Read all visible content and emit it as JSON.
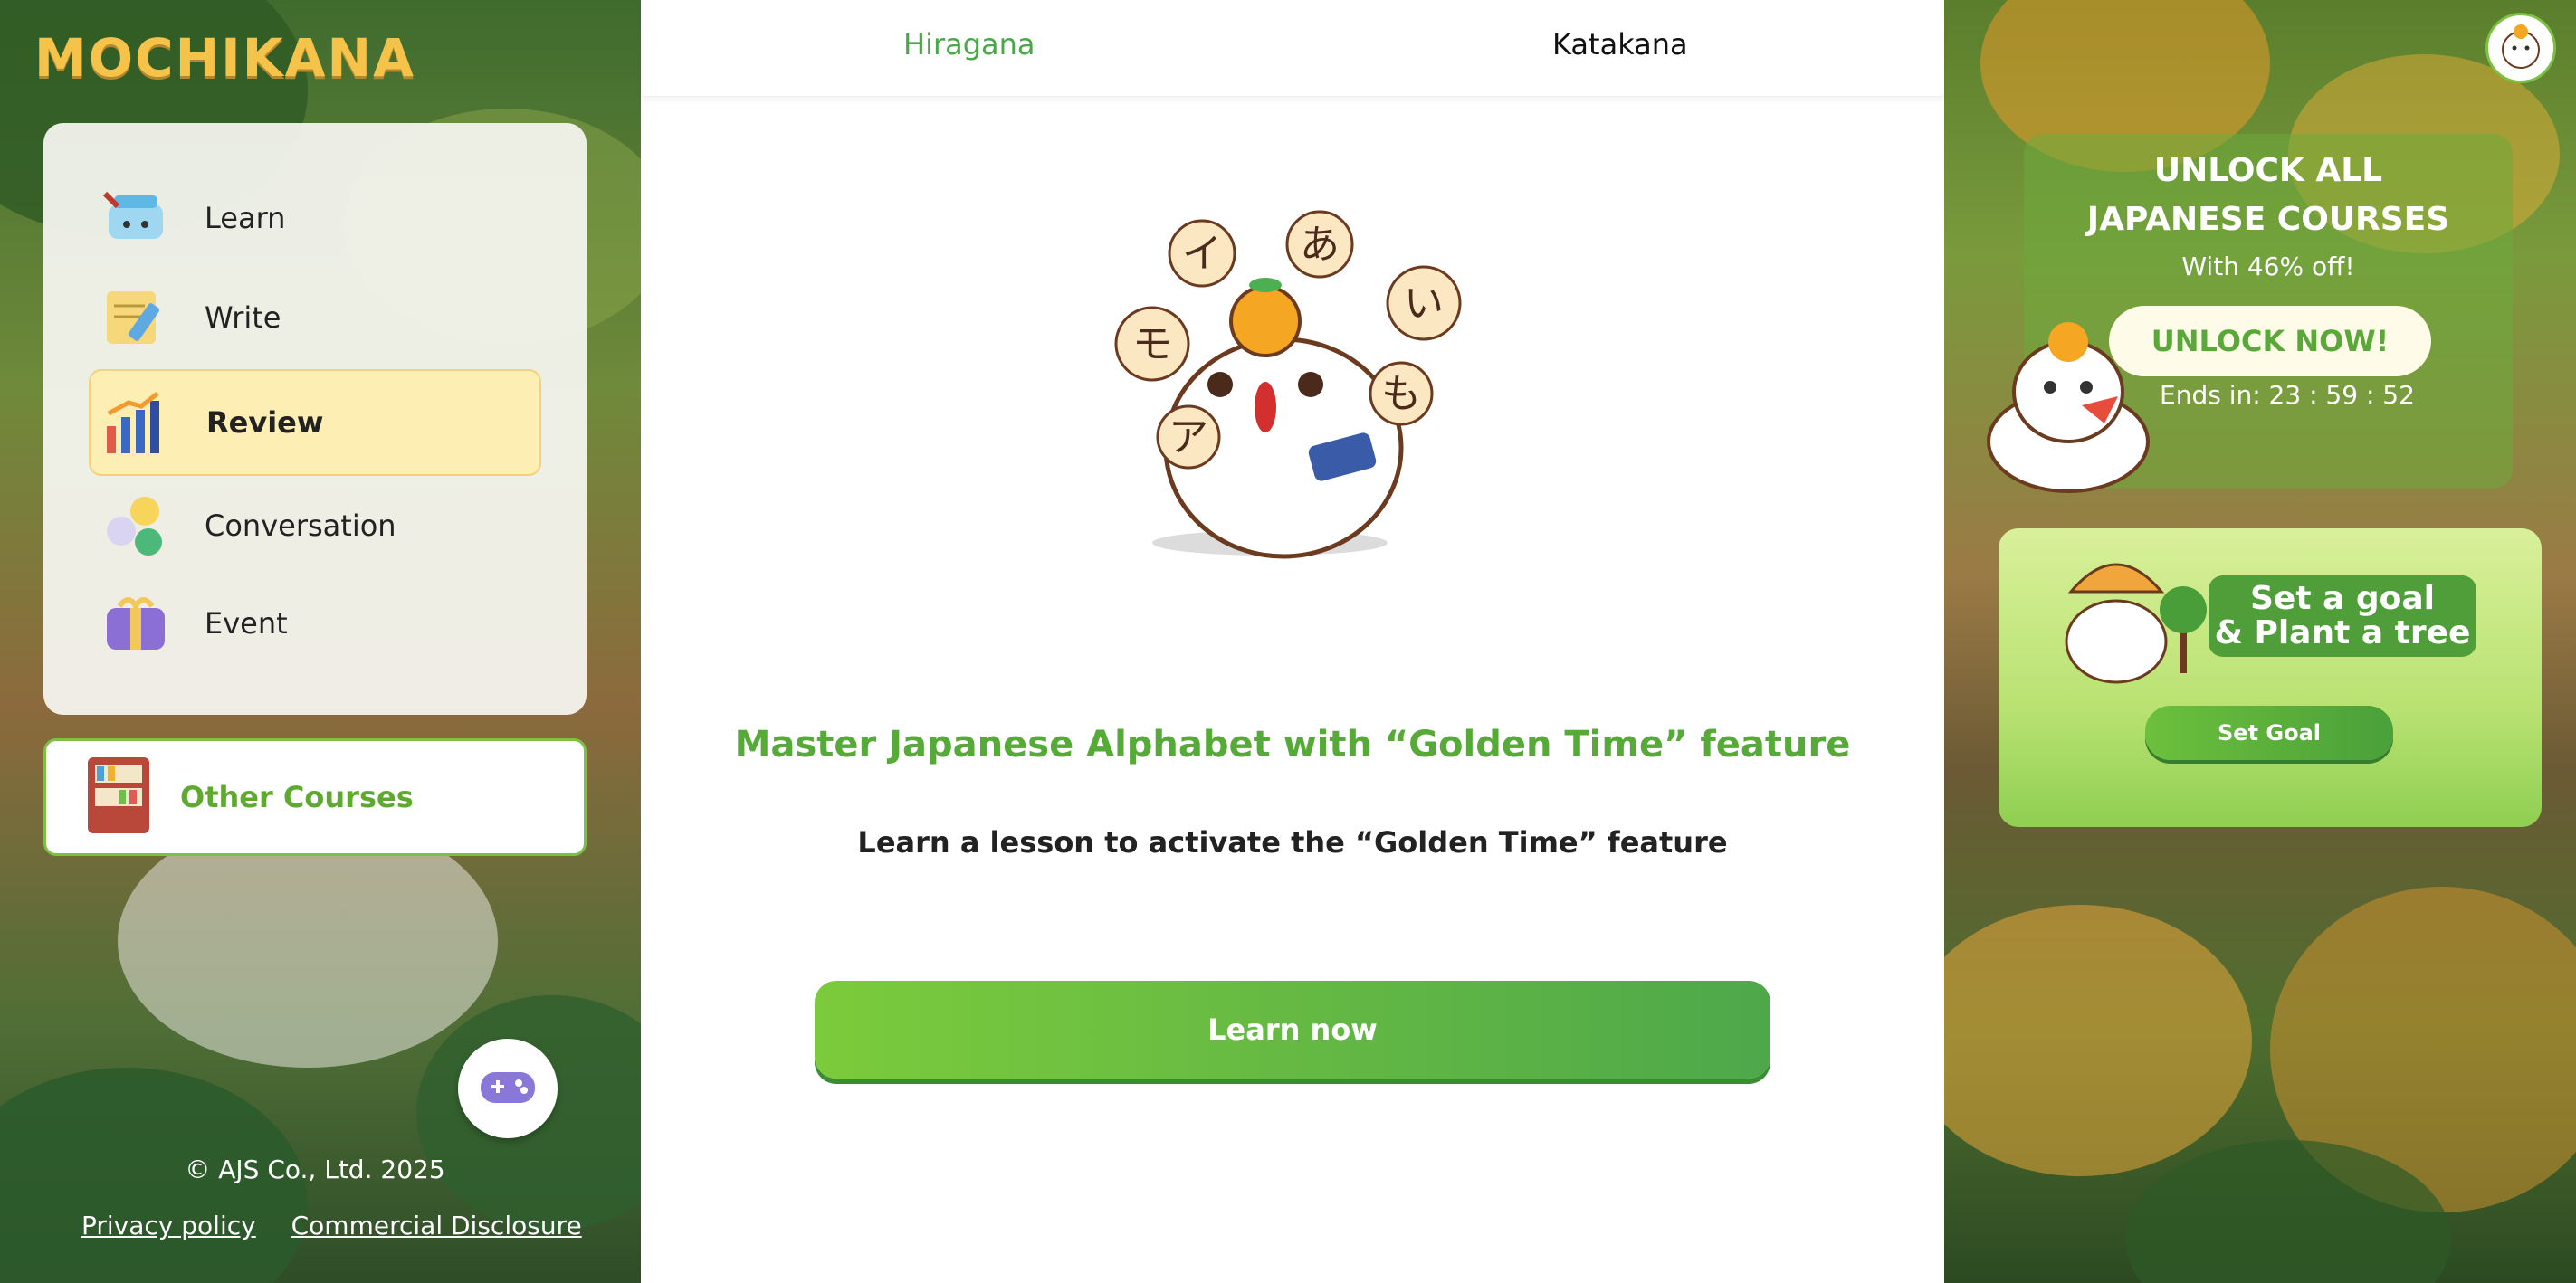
{
  "brand": {
    "logo_text": "MOCHIKANA"
  },
  "sidebar": {
    "items": [
      {
        "label": "Learn",
        "icon": "cap-icon"
      },
      {
        "label": "Write",
        "icon": "pencil-icon"
      },
      {
        "label": "Review",
        "icon": "bar-chart-icon",
        "active": true
      },
      {
        "label": "Conversation",
        "icon": "chat-icon"
      },
      {
        "label": "Event",
        "icon": "gift-icon"
      }
    ],
    "other_courses": "Other Courses"
  },
  "footer": {
    "copyright": "© AJS Co., Ltd. 2025",
    "privacy": "Privacy policy",
    "disclosure": "Commercial Disclosure"
  },
  "tabs": {
    "hiragana": "Hiragana",
    "katakana": "Katakana"
  },
  "main": {
    "headline": "Master Japanese Alphabet with “Golden Time” feature",
    "subline": "Learn a lesson to activate the “Golden Time” feature",
    "cta": "Learn now",
    "kana": [
      "イ",
      "あ",
      "い",
      "モ",
      "も",
      "ア"
    ]
  },
  "promo": {
    "title_line1": "UNLOCK ALL",
    "title_line2": "JAPANESE COURSES",
    "subtitle": "With 46% off!",
    "button": "UNLOCK NOW!",
    "countdown": "Ends in: 23 : 59 : 52"
  },
  "goal": {
    "banner_line1": "Set a goal",
    "banner_line2": "& Plant a tree",
    "button": "Set Goal"
  },
  "colors": {
    "accent_green": "#55aa38",
    "active_bg": "#fdeeb3",
    "logo_yellow": "#f5c34a"
  }
}
